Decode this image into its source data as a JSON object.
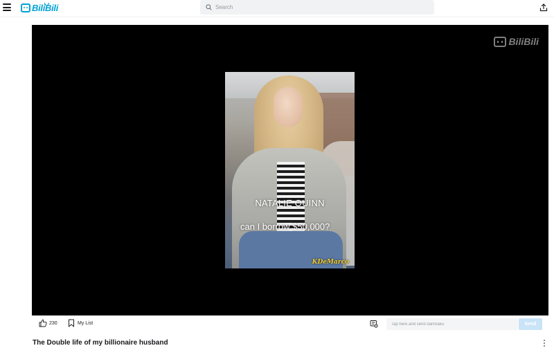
{
  "header": {
    "logo_text": "BiliBili",
    "search_placeholder": "Search"
  },
  "player": {
    "watermark_text": "BiliBili",
    "subtitle_name": "NATALIE QUINN",
    "subtitle_line": "can I borrow $50,000?",
    "channel_tag": "KDeMarco"
  },
  "actions": {
    "like_count": "230",
    "mylist_label": "My List",
    "danmaku_placeholder": "Tap here and send danmaku",
    "send_label": "Send"
  },
  "video": {
    "title": "The Double life of my billionaire husband"
  },
  "colors": {
    "brand": "#00a1d6",
    "send_button": "#c9e3f7"
  }
}
